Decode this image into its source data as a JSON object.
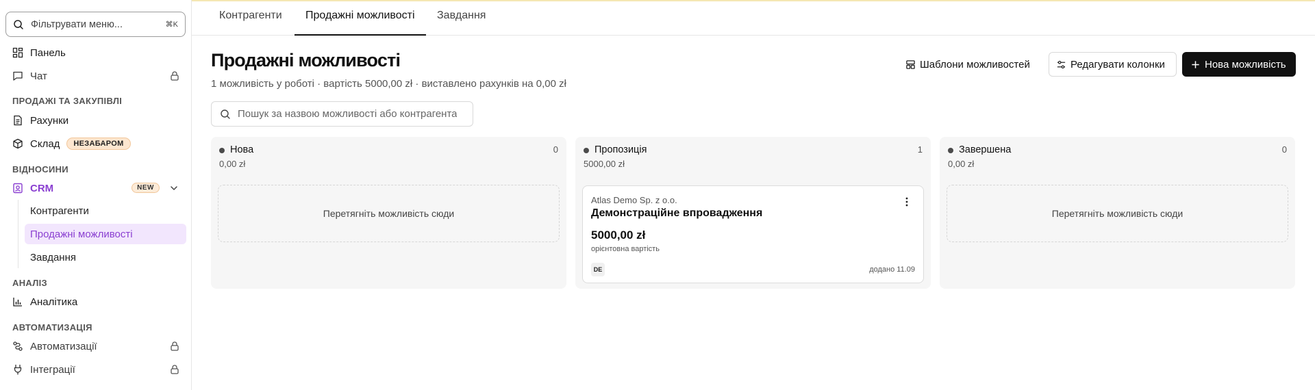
{
  "sidebar": {
    "filter_placeholder": "Фільтрувати меню...",
    "filter_shortcut": "⌘K",
    "items": {
      "panel": "Панель",
      "chat": "Чат",
      "invoices": "Рахунки",
      "warehouse": "Склад",
      "warehouse_badge": "НЕЗАБАРОМ",
      "crm": "CRM",
      "crm_badge": "NEW",
      "analytics": "Аналітика",
      "automations": "Автоматизації",
      "integrations": "Інтеграції"
    },
    "sections": {
      "sales": "ПРОДАЖІ ТА ЗАКУПІВЛІ",
      "relations": "ВІДНОСИНИ",
      "analysis": "АНАЛІЗ",
      "automation": "АВТОМАТИЗАЦІЯ"
    },
    "crm_sub": [
      "Контрагенти",
      "Продажні можливості",
      "Завдання"
    ]
  },
  "tabs": [
    "Контрагенти",
    "Продажні можливості",
    "Завдання"
  ],
  "header": {
    "title": "Продажні можливості",
    "subtitle": "1 можливість у роботі · вартість 5000,00 zł · виставлено рахунків на 0,00 zł",
    "templates_button": "Шаблони можливостей",
    "edit_columns_button": "Редагувати колонки",
    "new_button": "Нова можливість"
  },
  "search": {
    "placeholder": "Пошук за назвою можливості або контрагента"
  },
  "columns": [
    {
      "name": "Нова",
      "count": "0",
      "amount": "0,00 zł",
      "empty_text": "Перетягніть можливість сюди"
    },
    {
      "name": "Пропозиція",
      "count": "1",
      "amount": "5000,00 zł"
    },
    {
      "name": "Завершена",
      "count": "0",
      "amount": "0,00 zł",
      "empty_text": "Перетягніть можливість сюди"
    }
  ],
  "card": {
    "company": "Atlas Demo Sp. z o.o.",
    "title": "Демонстраційне впровадження",
    "value": "5000,00 zł",
    "value_label": "орієнтовна вартість",
    "avatar": "DE",
    "added": "додано 11.09"
  },
  "colors": {
    "accent": "#8a3fd1",
    "active_bg": "#f2e6fd",
    "primary_button": "#111111"
  }
}
